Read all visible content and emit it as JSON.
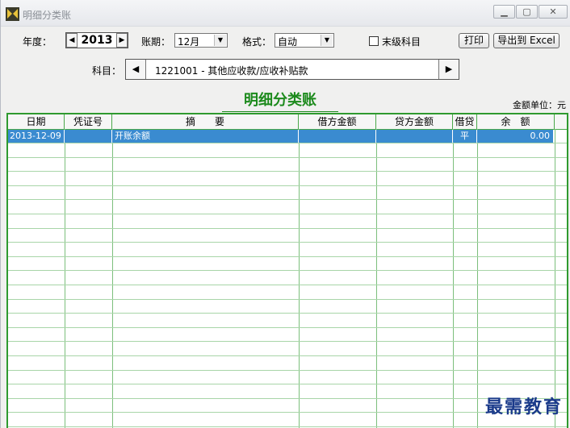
{
  "window": {
    "title": "明细分类账",
    "min_icon": "minimize-icon",
    "max_icon": "maximize-icon",
    "close_icon": "close-icon"
  },
  "toolbar": {
    "year_label": "年度：",
    "year_value": "2013",
    "period_label": "账期：",
    "period_value": "12月",
    "format_label": "格式：",
    "format_value": "自动",
    "last_level_label": "末级科目",
    "last_level_checked": false,
    "print_label": "打印",
    "export_label": "导出到 Excel"
  },
  "subject": {
    "label": "科目：",
    "value": "1221001 - 其他应收款/应收补贴款"
  },
  "report": {
    "title": "明细分类账",
    "unit": "金额单位：元"
  },
  "table": {
    "headers": [
      "日期",
      "凭证号",
      "摘　　要",
      "借方金额",
      "贷方金额",
      "借贷",
      "余　额"
    ],
    "rows": [
      {
        "date": "2013-12-09",
        "voucher": "",
        "summary": "开账余额",
        "debit": "",
        "credit": "",
        "dir": "平",
        "balance": "0.00"
      }
    ]
  },
  "watermark": "最需教育",
  "colors": {
    "accent_green": "#1c8a1c",
    "selection_blue": "#3a8bd0",
    "grid_green": "#2f9a2f"
  }
}
